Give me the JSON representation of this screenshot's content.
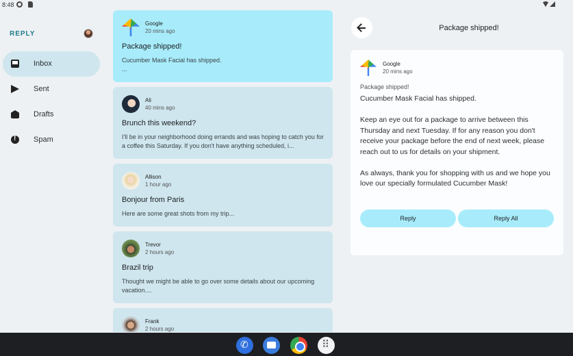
{
  "status_bar": {
    "time": "8:48"
  },
  "app": {
    "brand": "REPLY"
  },
  "nav": {
    "items": [
      {
        "label": "Inbox",
        "icon": "inbox-icon",
        "active": true
      },
      {
        "label": "Sent",
        "icon": "send-icon",
        "active": false
      },
      {
        "label": "Drafts",
        "icon": "drafts-icon",
        "active": false
      },
      {
        "label": "Spam",
        "icon": "spam-icon",
        "active": false
      }
    ]
  },
  "emails": [
    {
      "sender": "Google",
      "time": "20 mins ago",
      "subject": "Package shipped!",
      "preview": "Cucumber Mask Facial has shipped.\n...",
      "selected": true
    },
    {
      "sender": "Ali",
      "time": "40 mins ago",
      "subject": "Brunch this weekend?",
      "preview": "I'll be in your neighborhood doing errands and was hoping to catch you for a coffee this Saturday. If you don't have anything scheduled, i...",
      "selected": false
    },
    {
      "sender": "Allison",
      "time": "1 hour ago",
      "subject": "Bonjour from Paris",
      "preview": "Here are some great shots from my trip...",
      "selected": false
    },
    {
      "sender": "Trevor",
      "time": "2 hours ago",
      "subject": "Brazil trip",
      "preview": "Thought we might be able to go over some details about our upcoming vacation....",
      "selected": false
    },
    {
      "sender": "Frank",
      "time": "2 hours ago",
      "subject": "",
      "preview": "",
      "selected": false
    }
  ],
  "detail": {
    "title": "Package shipped!",
    "sender": "Google",
    "time": "20 mins ago",
    "subject": "Package shipped!",
    "body": "Cucumber Mask Facial has shipped.\n\nKeep an eye out for a package to arrive between this Thursday and next Tuesday. If for any reason you don't receive your package before the end of next week, please reach out to us for details on your shipment.\n\nAs always, thank you for shopping with us and we hope you love our specially formulated Cucumber Mask!",
    "reply_label": "Reply",
    "reply_all_label": "Reply All"
  },
  "colors": {
    "accent": "#1f7a8c",
    "selected_card": "#a8ecfb",
    "card": "#cfe6ee",
    "background": "#eef1f4"
  }
}
